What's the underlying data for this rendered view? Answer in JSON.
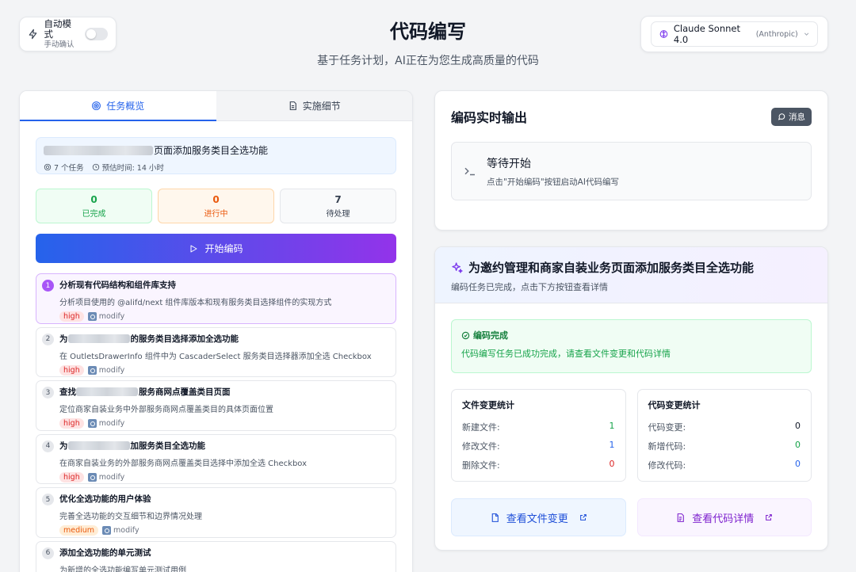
{
  "auto_mode": {
    "title": "自动模式",
    "subtitle": "手动确认",
    "enabled": false
  },
  "header": {
    "title": "代码编写",
    "subtitle": "基于任务计划，AI正在为您生成高质量的代码"
  },
  "model": {
    "name": "Claude Sonnet 4.0",
    "vendor": "(Anthropic)"
  },
  "tabs": [
    {
      "label": "任务概览",
      "icon": "target-icon",
      "active": true
    },
    {
      "label": "实施细节",
      "icon": "document-icon",
      "active": false
    }
  ],
  "task": {
    "title": "页面添加服务类目全选功能",
    "count": "7 个任务",
    "estimate": "预估时间: 14 小时"
  },
  "stats": [
    {
      "num": "0",
      "label": "已完成"
    },
    {
      "num": "0",
      "label": "进行中"
    },
    {
      "num": "7",
      "label": "待处理"
    }
  ],
  "start_button": "开始编码",
  "tasks": [
    {
      "index": "1",
      "title_prefix": "",
      "title": "分析现有代码结构和组件库支持",
      "desc": "分析项目使用的 @alifd/next 组件库版本和现有服务类目选择组件的实现方式",
      "priority": "high",
      "type": "modify"
    },
    {
      "index": "2",
      "title_prefix": "为",
      "title": "的服务类目选择添加全选功能",
      "desc": "在 OutletsDrawerInfo 组件中为 CascaderSelect 服务类目选择器添加全选 Checkbox",
      "priority": "high",
      "type": "modify"
    },
    {
      "index": "3",
      "title_prefix": "查找",
      "title": "服务商网点覆盖类目页面",
      "desc": "定位商家自装业务中外部服务商网点覆盖类目的具体页面位置",
      "priority": "high",
      "type": "modify"
    },
    {
      "index": "4",
      "title_prefix": "为",
      "title": "加服务类目全选功能",
      "desc": "在商家自装业务的外部服务商网点覆盖类目选择中添加全选 Checkbox",
      "priority": "high",
      "type": "modify"
    },
    {
      "index": "5",
      "title_prefix": "",
      "title": "优化全选功能的用户体验",
      "desc": "完善全选功能的交互细节和边界情况处理",
      "priority": "medium",
      "type": "modify"
    },
    {
      "index": "6",
      "title_prefix": "",
      "title": "添加全选功能的单元测试",
      "desc": "为新增的全选功能编写单元测试用例",
      "priority": "",
      "type": ""
    }
  ],
  "output": {
    "title": "编码实时输出",
    "message_button": "消息",
    "wait_title": "等待开始",
    "wait_sub": "点击\"开始编码\"按钮启动AI代码编写"
  },
  "summary": {
    "title": "为邀约管理和商家自装业务页面添加服务类目全选功能",
    "subtitle": "编码任务已完成，点击下方按钮查看详情",
    "done_title": "编码完成",
    "done_text": "代码编写任务已成功完成，请查看文件变更和代码详情",
    "file_stats": {
      "title": "文件变更统计",
      "rows": [
        {
          "label": "新建文件:",
          "value": "1"
        },
        {
          "label": "修改文件:",
          "value": "1"
        },
        {
          "label": "删除文件:",
          "value": "0"
        }
      ]
    },
    "code_stats": {
      "title": "代码变更统计",
      "rows": [
        {
          "label": "代码变更:",
          "value": "0"
        },
        {
          "label": "新增代码:",
          "value": "0"
        },
        {
          "label": "修改代码:",
          "value": "0"
        }
      ]
    },
    "view_files": "查看文件变更",
    "view_code": "查看代码详情"
  },
  "colors": {
    "accent_blue": "#2563eb",
    "accent_purple": "#9333ea",
    "success": "#16a34a",
    "warning": "#ea580c",
    "danger": "#dc2626"
  }
}
